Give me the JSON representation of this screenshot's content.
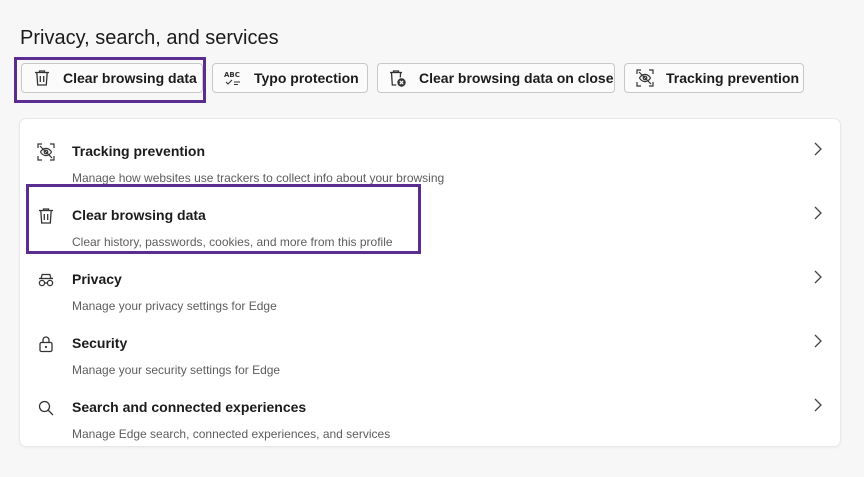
{
  "page": {
    "title": "Privacy, search, and services"
  },
  "quick_links": [
    {
      "label": "Clear browsing data",
      "icon": "trash-icon"
    },
    {
      "label": "Typo protection",
      "icon": "spellcheck-abc-icon"
    },
    {
      "label": "Clear browsing data on close",
      "icon": "trash-clock-icon"
    },
    {
      "label": "Tracking prevention",
      "icon": "tracking-prevention-icon"
    }
  ],
  "sections": [
    {
      "title": "Tracking prevention",
      "description": "Manage how websites use trackers to collect info about your browsing",
      "icon": "tracking-prevention-icon"
    },
    {
      "title": "Clear browsing data",
      "description": "Clear history, passwords, cookies, and more from this profile",
      "icon": "trash-icon"
    },
    {
      "title": "Privacy",
      "description": "Manage your privacy settings for Edge",
      "icon": "incognito-glasses-icon"
    },
    {
      "title": "Security",
      "description": "Manage your security settings for Edge",
      "icon": "lock-icon"
    },
    {
      "title": "Search and connected experiences",
      "description": "Manage Edge search, connected experiences, and services",
      "icon": "search-icon"
    }
  ],
  "colors": {
    "highlight": "#5b2d91",
    "background": "#f7f7f7",
    "card": "#ffffff"
  }
}
